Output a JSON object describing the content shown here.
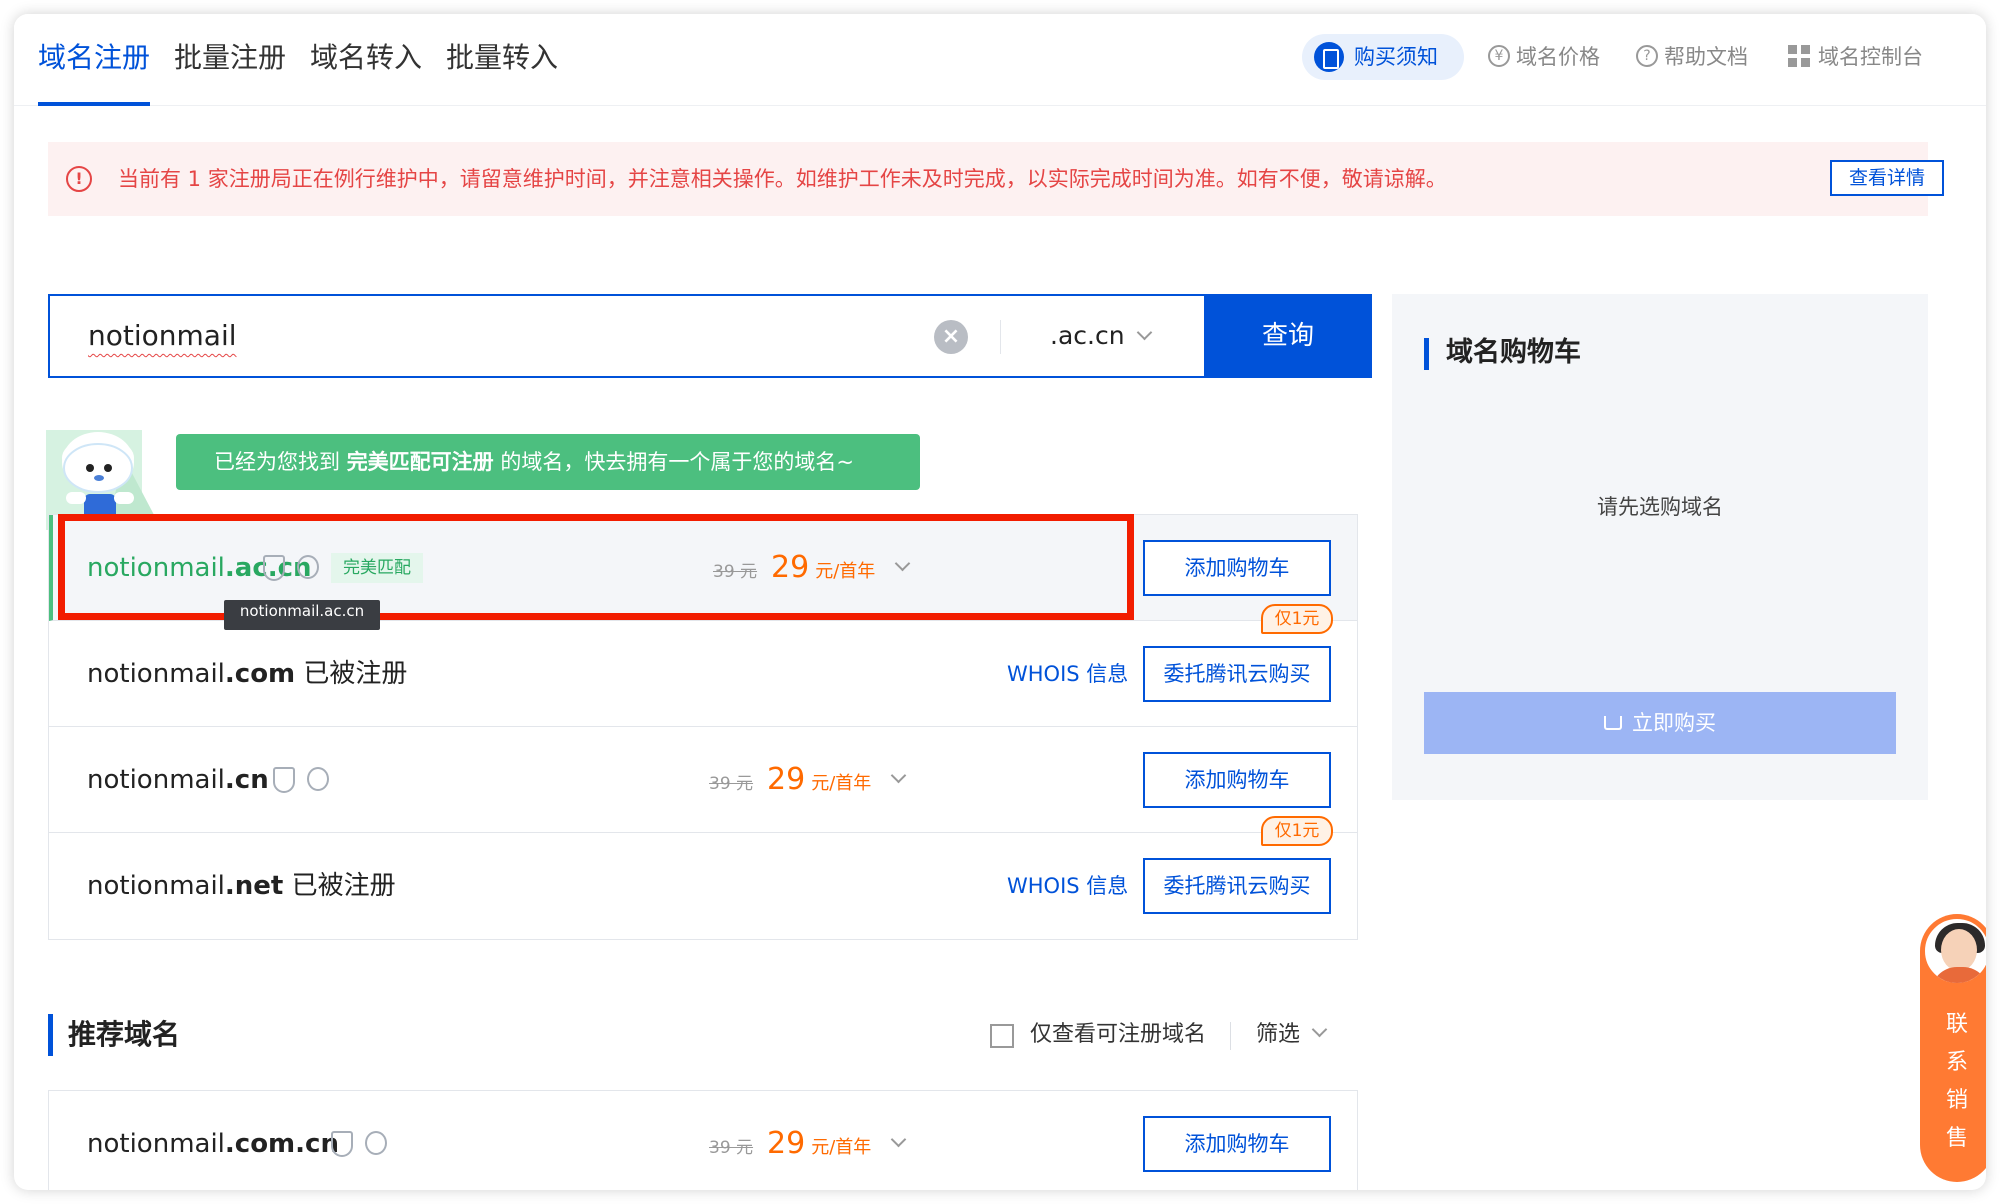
{
  "nav": {
    "tabs": [
      {
        "label": "域名注册",
        "active": true
      },
      {
        "label": "批量注册"
      },
      {
        "label": "域名转入"
      },
      {
        "label": "批量转入"
      }
    ],
    "purchase_notice": "购买须知",
    "links": {
      "price": "域名价格",
      "help": "帮助文档",
      "console": "域名控制台"
    }
  },
  "notice": {
    "text": "当前有 1 家注册局正在例行维护中，请留意维护时间，并注意相关操作。如维护工作未及时完成，以实际完成时间为准。如有不便，敬请谅解。",
    "detail_button": "查看详情"
  },
  "search": {
    "query": "notionmail",
    "suffix": ".ac.cn",
    "submit": "查询"
  },
  "banner": {
    "prefix": "已经为您找到",
    "highlight": "完美匹配可注册",
    "suffix": "的域名，快去拥有一个属于您的域名~"
  },
  "results": [
    {
      "name": "notionmail",
      "tld": ".ac.cn",
      "tag": "完美匹配",
      "old_price": "39 元",
      "price": "29",
      "unit": "元/首年",
      "button": "添加购物车",
      "tooltip": "notionmail.ac.cn"
    },
    {
      "name": "notionmail",
      "tld": ".com",
      "status": "已被注册",
      "whois": "WHOIS 信息",
      "button": "委托腾讯云购买",
      "badge": "仅1元"
    },
    {
      "name": "notionmail",
      "tld": ".cn",
      "old_price": "39 元",
      "price": "29",
      "unit": "元/首年",
      "button": "添加购物车"
    },
    {
      "name": "notionmail",
      "tld": ".net",
      "status": "已被注册",
      "whois": "WHOIS 信息",
      "button": "委托腾讯云购买",
      "badge": "仅1元"
    }
  ],
  "recommended": {
    "title": "推荐域名",
    "only_available": "仅查看可注册域名",
    "filter": "筛选",
    "items": [
      {
        "name": "notionmail",
        "tld": ".com.cn",
        "old_price": "39 元",
        "price": "29",
        "unit": "元/首年",
        "button": "添加购物车"
      }
    ]
  },
  "cart": {
    "title": "域名购物车",
    "empty": "请先选购域名",
    "buy_now": "立即购买"
  },
  "contact": {
    "label": "联系销售"
  },
  "colors": {
    "primary": "#0052d9",
    "success": "#4cbf7f",
    "price": "#ff6a00",
    "alert": "#e54545",
    "highlight_box": "#f21d00"
  }
}
